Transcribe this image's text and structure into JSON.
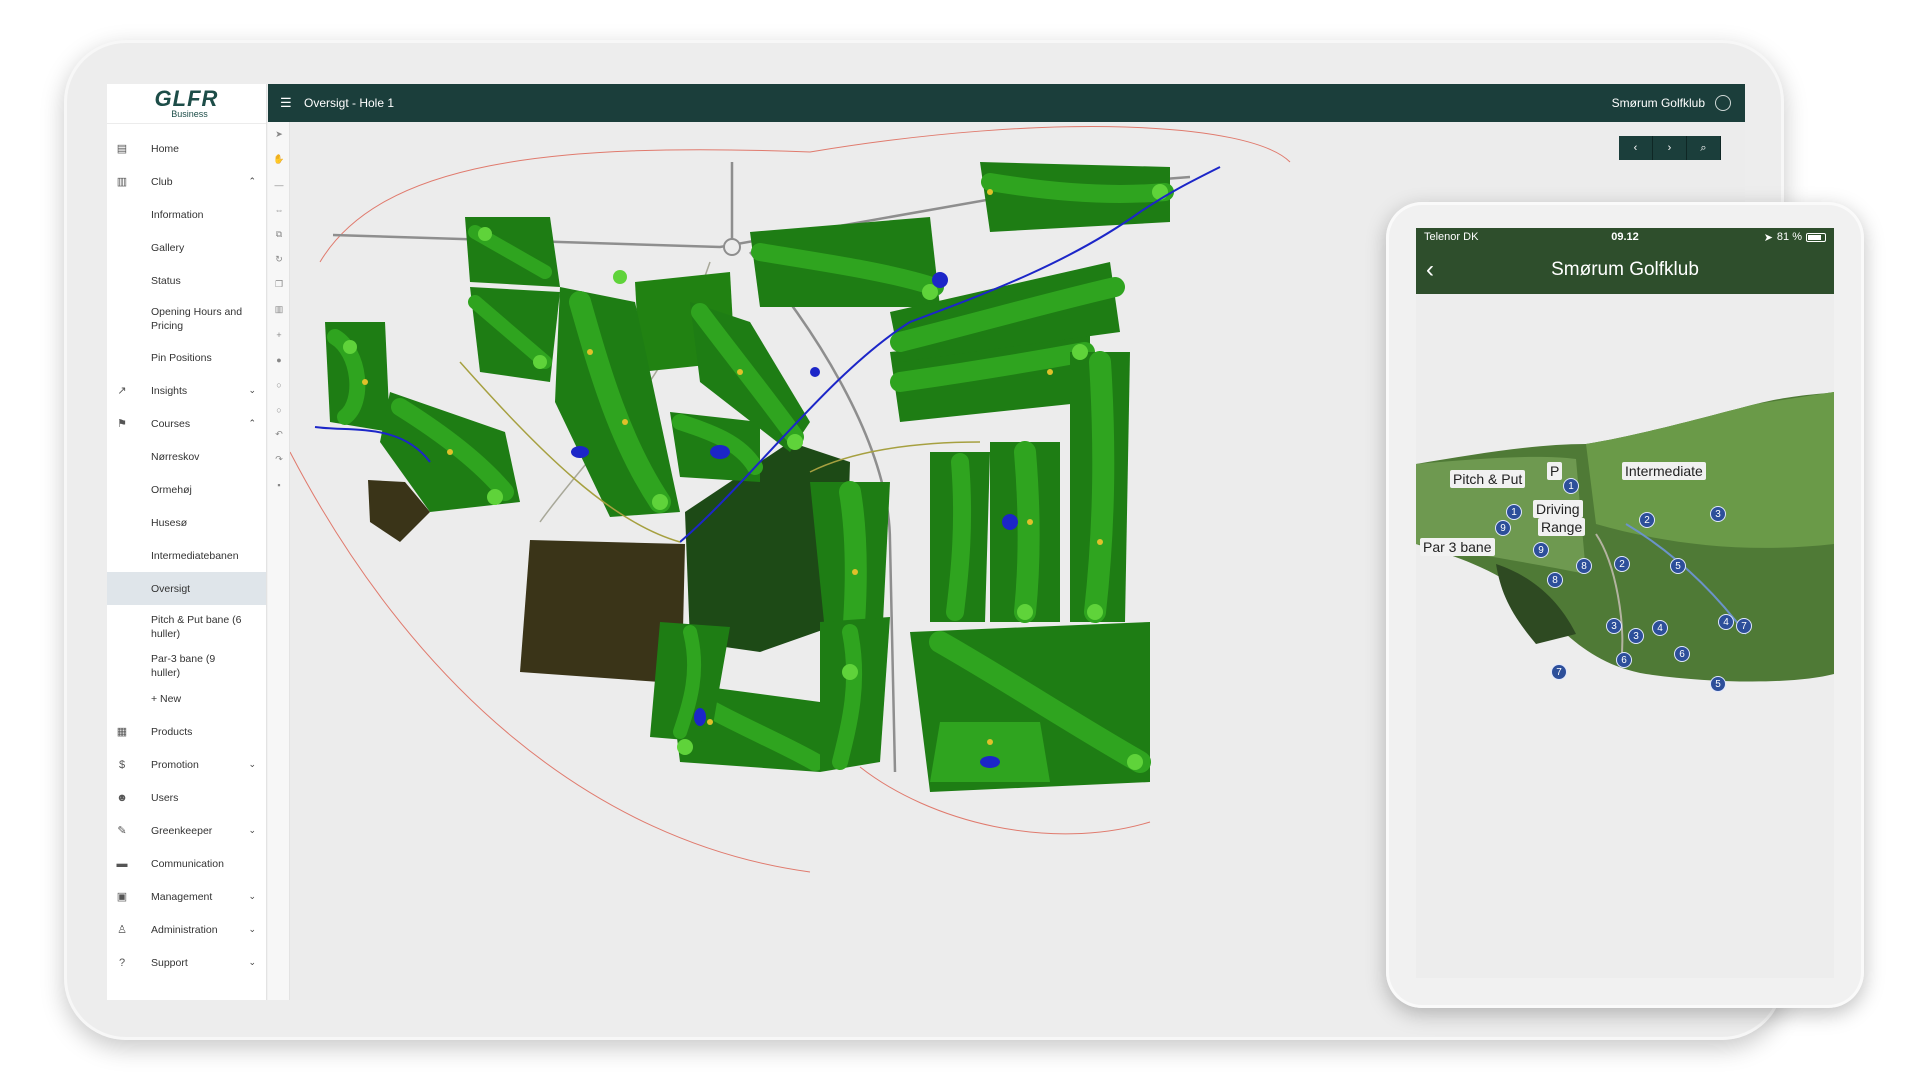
{
  "app": {
    "logo_main": "GLFR",
    "logo_sub": "Business",
    "page_title": "Oversigt - Hole 1",
    "club_name": "Smørum Golfklub"
  },
  "sidebar": {
    "items": [
      {
        "label": "Home",
        "icon": "home-icon",
        "glyph": "▤"
      },
      {
        "label": "Club",
        "icon": "building-icon",
        "glyph": "▥",
        "chevron": "up"
      },
      {
        "label": "Information",
        "sub": true
      },
      {
        "label": "Gallery",
        "sub": true
      },
      {
        "label": "Status",
        "sub": true
      },
      {
        "label": "Opening Hours and Pricing",
        "sub": true,
        "tall": true
      },
      {
        "label": "Pin Positions",
        "sub": true
      },
      {
        "label": "Insights",
        "icon": "trend-icon",
        "glyph": "↗",
        "chevron": "down"
      },
      {
        "label": "Courses",
        "icon": "flag-icon",
        "glyph": "⚑",
        "chevron": "up"
      },
      {
        "label": "Nørreskov",
        "sub": true
      },
      {
        "label": "Ormehøj",
        "sub": true
      },
      {
        "label": "Husesø",
        "sub": true
      },
      {
        "label": "Intermediatebanen",
        "sub": true
      },
      {
        "label": "Oversigt",
        "sub": true,
        "active": true
      },
      {
        "label": "Pitch & Put bane (6 huller)",
        "sub": true,
        "tall": true
      },
      {
        "label": "Par-3 bane (9 huller)",
        "sub": true
      },
      {
        "label": "+ New",
        "sub": true
      },
      {
        "label": "Products",
        "icon": "products-icon",
        "glyph": "▦"
      },
      {
        "label": "Promotion",
        "icon": "dollar-icon",
        "glyph": "$",
        "chevron": "down"
      },
      {
        "label": "Users",
        "icon": "users-icon",
        "glyph": "☻"
      },
      {
        "label": "Greenkeeper",
        "icon": "wrench-icon",
        "glyph": "✎",
        "chevron": "down"
      },
      {
        "label": "Communication",
        "icon": "chat-icon",
        "glyph": "▬"
      },
      {
        "label": "Management",
        "icon": "clipboard-icon",
        "glyph": "▣",
        "chevron": "down"
      },
      {
        "label": "Administration",
        "icon": "person-icon",
        "glyph": "♙",
        "chevron": "down"
      },
      {
        "label": "Support",
        "icon": "help-icon",
        "glyph": "?",
        "chevron": "down"
      }
    ]
  },
  "toolbar": {
    "tools": [
      "pointer-icon",
      "hand-icon",
      "minus-icon",
      "move-icon",
      "copy-icon",
      "rotate-icon",
      "duplicate-icon",
      "trash-icon",
      "plus-icon",
      "circle-icon",
      "circle-outline-icon",
      "circle-outline-icon",
      "undo-icon",
      "redo-icon",
      "save-icon"
    ]
  },
  "map_nav": {
    "prev": "‹",
    "next": "›",
    "search": "⌕"
  },
  "phone": {
    "carrier": "Telenor DK",
    "time": "09.12",
    "battery": "81 %",
    "battery_level": 0.81,
    "title": "Smørum Golfklub",
    "labels": {
      "pitch_put": "Pitch & Put",
      "parking": "P",
      "intermediate": "Intermediate",
      "driving": "Driving",
      "range": "Range",
      "par3": "Par 3 bane"
    },
    "hole_markers": [
      "1",
      "1",
      "9",
      "9",
      "8",
      "8",
      "2",
      "2",
      "3",
      "3",
      "5",
      "4",
      "7",
      "4",
      "3",
      "6",
      "6",
      "7",
      "5"
    ]
  },
  "colors": {
    "topbar": "#1b3e3b",
    "fairway": "#2fa41f",
    "rough": "#1e7d14",
    "green": "#5fd33a",
    "forest": "#1d4a16",
    "dark_area": "#3a3418",
    "water": "#1c26c8",
    "phone_header": "#2e4e2c",
    "hole_marker": "#2d4f9a"
  }
}
